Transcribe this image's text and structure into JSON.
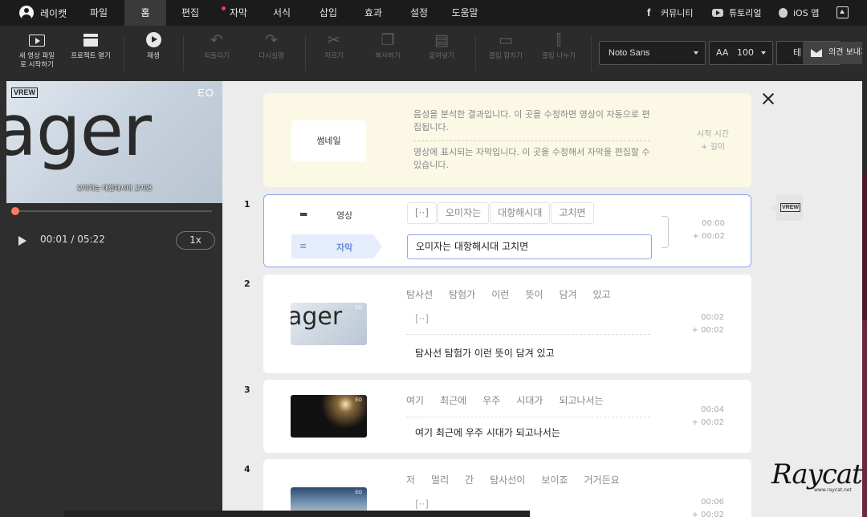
{
  "menu": {
    "user": "레이캣",
    "items": [
      "파일",
      "홈",
      "편집",
      "자막",
      "서식",
      "삽입",
      "효과",
      "설정",
      "도움말"
    ],
    "active": "홈",
    "right": {
      "community": "커뮤니티",
      "tutorial": "튜토리얼",
      "ios": "iOS 앱"
    }
  },
  "toolbar": {
    "new_video": "새 영상 파일로 시작하기",
    "open_project": "프로젝트 열기",
    "play": "재생",
    "undo": "되돌리기",
    "redo": "다시실행",
    "cut": "자르기",
    "copy": "복사하기",
    "paste": "붙여넣기",
    "merge_clip": "클립 합치기",
    "split_clip": "클립 나누기",
    "font": "Noto Sans",
    "font_size": "100",
    "theme_partial": "테"
  },
  "feedback": {
    "label": "의견 보내기"
  },
  "player": {
    "video_overlay_text": "ager",
    "brand_left": "VREW",
    "brand_right": "EO",
    "caption": "오미자는 대항해시대 고치면",
    "time": "00:01 / 05:22",
    "speed": "1x",
    "progress": 0.0
  },
  "legend": {
    "thumbnail": "썸네일",
    "line1": "음성을 분석한 결과입니다. 이 곳을 수정하면 영상이 자동으로 편집됩니다.",
    "line2": "영상에 표시되는 자막입니다. 이 곳을 수정해서 자막을 편집할 수 있습니다.",
    "time_label": "시작 시간",
    "length_label": "+ 길이"
  },
  "clips": [
    {
      "num": "1",
      "video_label": "영상",
      "subtitle_label": "자막",
      "words": [
        "[··]",
        "오미자는",
        "대항해시대",
        "고치면"
      ],
      "subtitle": "오미자는 대항해시대 고치면",
      "start": "00:00",
      "length": "+ 00:02"
    },
    {
      "num": "2",
      "thumb_text": "ager",
      "words": [
        "탐사선",
        "탐험가",
        "이런",
        "뜻이",
        "담겨",
        "있고"
      ],
      "gap": "[··]",
      "subtitle": "탐사선 탐험가 이런 뜻이 담겨 있고",
      "start": "00:02",
      "length": "+ 00:02"
    },
    {
      "num": "3",
      "words": [
        "여기",
        "최근에",
        "우주",
        "시대가",
        "되고나서는"
      ],
      "subtitle": "여기 최근에 우주 시대가 되고나서는",
      "start": "00:04",
      "length": "+ 00:02"
    },
    {
      "num": "4",
      "words": [
        "저",
        "멀리",
        "간",
        "탐사선이",
        "보이죠",
        "거거든요"
      ],
      "gap": "[··]",
      "start": "00:06",
      "length": "+ 00:02"
    }
  ],
  "watermark": {
    "name": "Raycat",
    "url": "www.raycat.net"
  },
  "colors": {
    "accent": "#8aa8e8",
    "recording_dot": "#ff3b4d",
    "seek_knob": "#ff7b5c"
  }
}
